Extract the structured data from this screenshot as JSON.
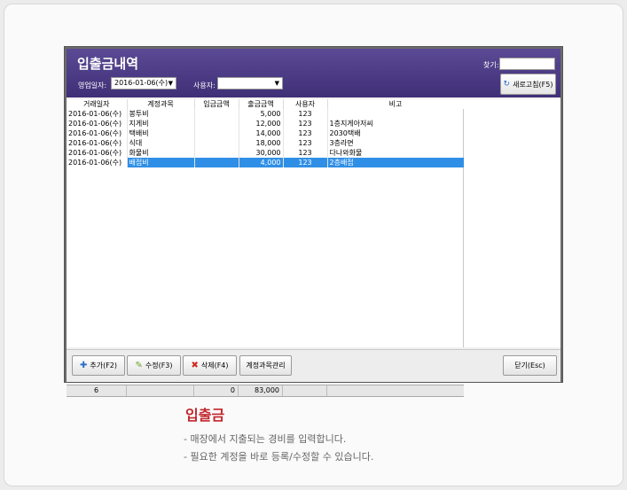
{
  "window": {
    "title": "입출금내역",
    "find_label": "찾기:",
    "date_label": "영업일자:",
    "date_value": "2016-01-06(수)",
    "user_label": "사용자:",
    "user_value": "",
    "refresh_label": "새로고침(F5)"
  },
  "table": {
    "columns": [
      "거래일자",
      "계정과목",
      "입금금액",
      "출금금액",
      "사용자",
      "비고"
    ],
    "rows": [
      {
        "date": "2016-01-06(수)",
        "account": "봉투비",
        "deposit": "",
        "withdraw": "5,000",
        "user": "123",
        "note": ""
      },
      {
        "date": "2016-01-06(수)",
        "account": "지게비",
        "deposit": "",
        "withdraw": "12,000",
        "user": "123",
        "note": "1층지게아저씨"
      },
      {
        "date": "2016-01-06(수)",
        "account": "택배비",
        "deposit": "",
        "withdraw": "14,000",
        "user": "123",
        "note": "2030택배"
      },
      {
        "date": "2016-01-06(수)",
        "account": "식대",
        "deposit": "",
        "withdraw": "18,000",
        "user": "123",
        "note": "3층라면"
      },
      {
        "date": "2016-01-06(수)",
        "account": "화물비",
        "deposit": "",
        "withdraw": "30,000",
        "user": "123",
        "note": "다나와화물"
      },
      {
        "date": "2016-01-06(수)",
        "account": "배접비",
        "deposit": "",
        "withdraw": "4,000",
        "user": "123",
        "note": "2층배접"
      }
    ],
    "footer": {
      "count": "6",
      "deposit_total": "0",
      "withdraw_total": "83,000"
    }
  },
  "buttons": {
    "add": "추가(F2)",
    "edit": "수정(F3)",
    "delete": "삭제(F4)",
    "accounts": "계정과목관리",
    "close": "닫기(Esc)"
  },
  "caption": {
    "title": "입출금",
    "line1": "- 매장에서 지출되는 경비를 입력합니다.",
    "line2": "- 필요한 계정을 바로 등록/수정할 수 있습니다."
  },
  "colors": {
    "header": "#4a3a85",
    "selection": "#2f8fe6",
    "accent": "#c1272d"
  }
}
